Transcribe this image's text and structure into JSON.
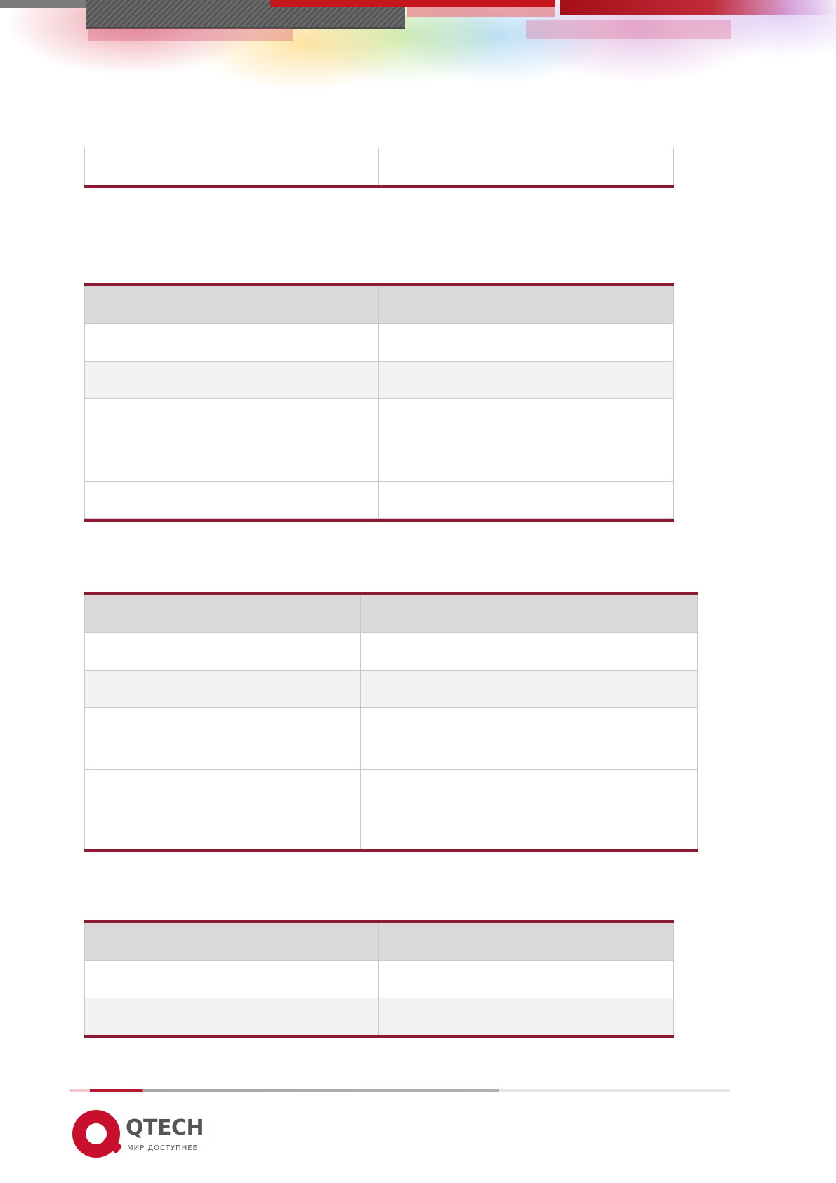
{
  "header": {
    "banner": "decorative-banner"
  },
  "tables": {
    "continued": {
      "rows": [
        [
          "",
          ""
        ]
      ]
    },
    "table_2": {
      "header": [
        "",
        ""
      ],
      "rows": [
        [
          "",
          ""
        ],
        [
          "",
          ""
        ],
        [
          "",
          ""
        ],
        [
          "",
          ""
        ]
      ]
    },
    "table_3": {
      "header": [
        "",
        ""
      ],
      "rows": [
        [
          "",
          ""
        ],
        [
          "",
          ""
        ],
        [
          "",
          ""
        ],
        [
          "",
          ""
        ]
      ]
    },
    "table_4": {
      "header": [
        "",
        ""
      ],
      "rows": [
        [
          "",
          ""
        ],
        [
          "",
          ""
        ]
      ]
    }
  },
  "footer": {
    "logo_name": "QTECH",
    "logo_tagline": "МИР ДОСТУПНЕЕ",
    "brand_color": "#c8102e",
    "rule_color": "#8c1a35"
  }
}
